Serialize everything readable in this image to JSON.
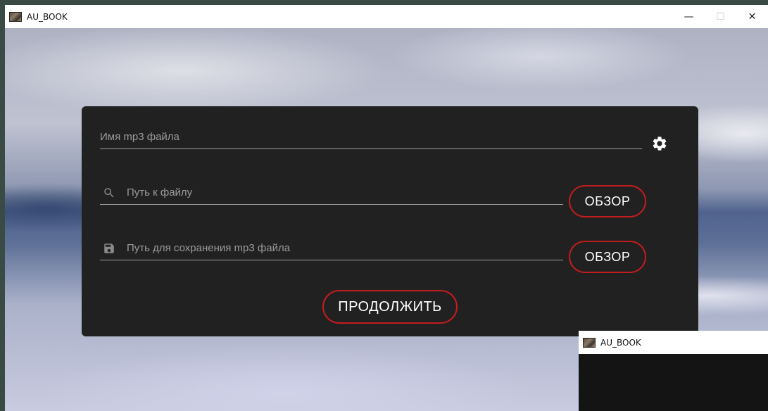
{
  "window": {
    "title": "AU_BOOK",
    "controls": {
      "minimize": "—",
      "maximize": "☐",
      "close": "✕"
    }
  },
  "form": {
    "filename_placeholder": "Имя mp3 файла",
    "file_path_placeholder": "Путь к файлу",
    "save_path_placeholder": "Путь для сохранения mp3 файла",
    "browse_file_label": "ОБЗОР",
    "browse_save_label": "ОБЗОР",
    "continue_label": "ПРОДОЛЖИТЬ",
    "icons": {
      "settings": "gear-icon",
      "file_path": "search-icon",
      "save_path": "floppy-disk-icon"
    }
  },
  "popup": {
    "title": "AU_BOOK"
  },
  "colors": {
    "panel": "#212121",
    "accent": "#c21d1d",
    "text": "#ffffff",
    "hint": "#9b9b9b"
  }
}
